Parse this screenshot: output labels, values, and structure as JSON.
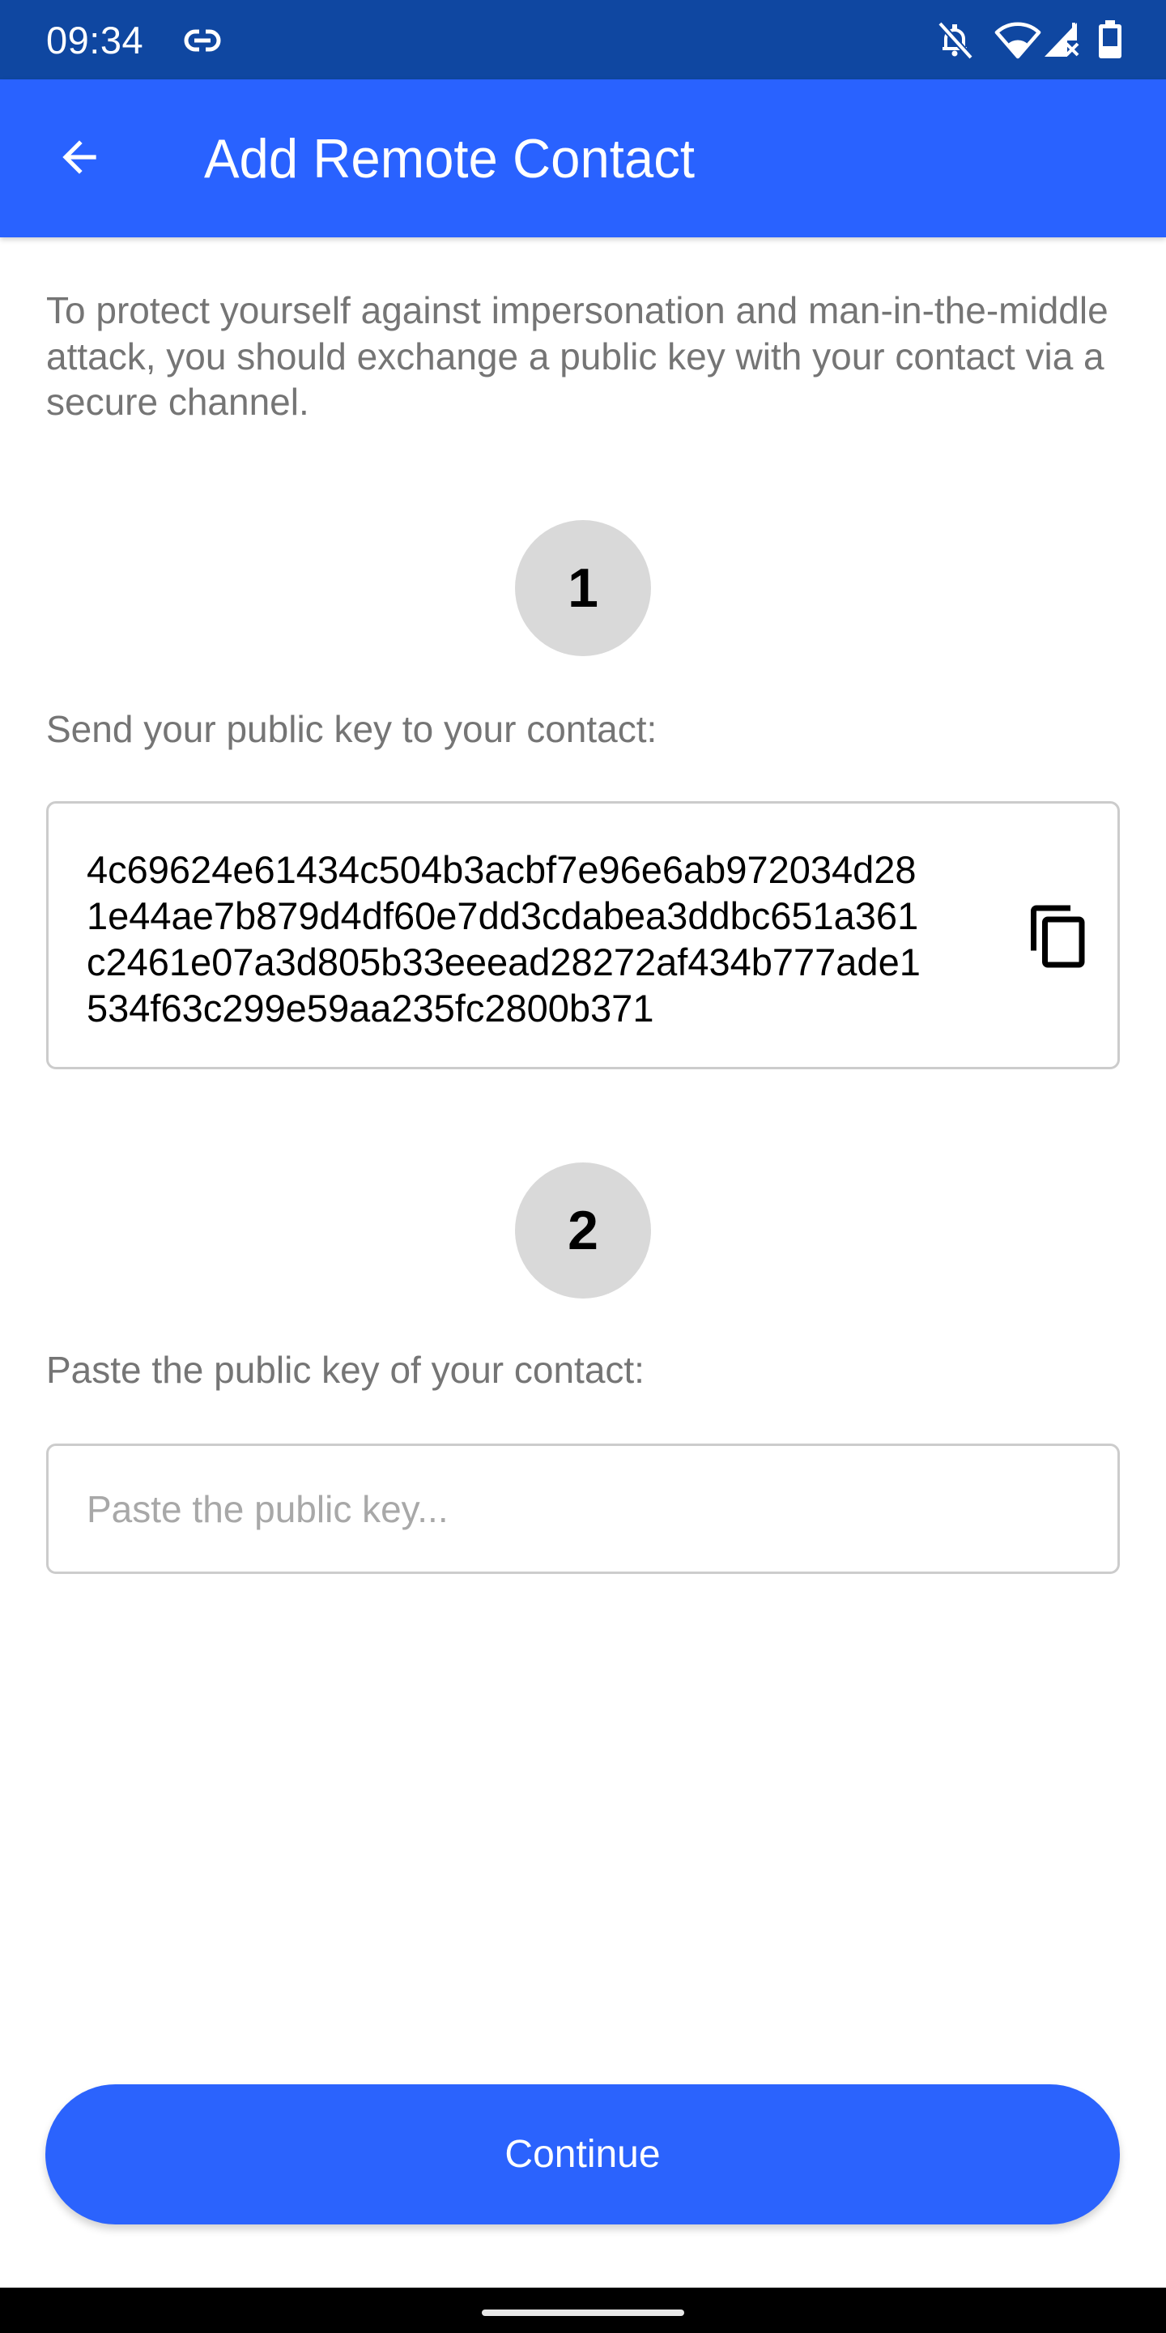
{
  "status_bar": {
    "time": "09:34",
    "left_icons": [
      "link-icon"
    ],
    "right_icons": [
      "bell-off-icon",
      "wifi-icon",
      "signal-no-service-icon",
      "battery-icon"
    ]
  },
  "app_bar": {
    "title": "Add Remote Contact",
    "back_icon": "arrow-back-icon",
    "background_color": "#2962ff",
    "status_color": "#0f47a1"
  },
  "intro": {
    "text": "To protect yourself against impersonation and man-in-the-middle attack, you should exchange a public key with your contact via a secure channel."
  },
  "step1": {
    "number": "1",
    "label": "Send your public key to your contact:",
    "public_key": "4c69624e61434c504b3acbf7e96e6ab972034d28\n1e44ae7b879d4df60e7dd3cdabea3ddbc651a361\nc2461e07a3d805b33eeead28272af434b777ade1\n534f63c299e59aa235fc2800b371",
    "copy_icon": "content-copy-icon"
  },
  "step2": {
    "number": "2",
    "label": "Paste the public key of your contact:",
    "input_value": "",
    "input_placeholder": "Paste the public key..."
  },
  "actions": {
    "continue_label": "Continue",
    "accent_color": "#2b63fd"
  }
}
